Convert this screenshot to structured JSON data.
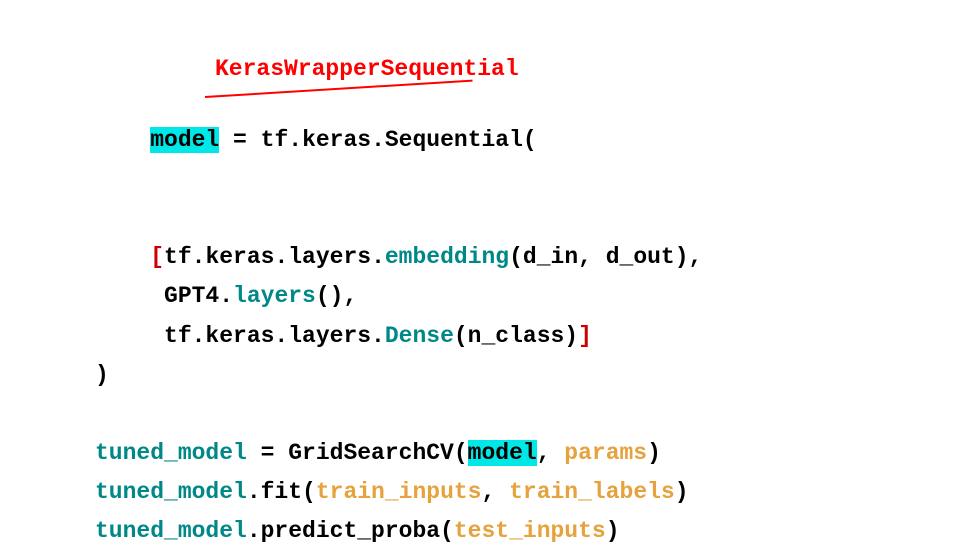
{
  "annotation": "KerasWrapperSequential",
  "code": {
    "l1": {
      "model": "model",
      "eq": " = ",
      "struck": "tf.keras.Sequential",
      "paren": "("
    },
    "l2": {
      "indent": "    ",
      "br_open": "[",
      "prefix": "tf.keras.layers.",
      "embedding": "embedding",
      "args": "(d_in, d_out),"
    },
    "l3": {
      "indent": "     ",
      "prefix": "GPT4.",
      "layers": "layers",
      "tail": "(),"
    },
    "l4": {
      "indent": "     ",
      "prefix": "tf.keras.layers.",
      "dense": "Dense",
      "args": "(n_class)",
      "br_close": "]"
    },
    "l5": {
      "text": ")"
    },
    "l6": {
      "text": " "
    },
    "l7": {
      "tuned": "tuned_model",
      "mid": " = GridSearchCV(",
      "model": "model",
      "comma": ", ",
      "params": "params",
      "close": ")"
    },
    "l8": {
      "tuned": "tuned_model",
      "fit": ".fit(",
      "a1": "train_inputs",
      "c": ", ",
      "a2": "train_labels",
      "close": ")"
    },
    "l9": {
      "tuned": "tuned_model",
      "pred": ".predict_proba(",
      "a1": "test_inputs",
      "close": ")"
    }
  }
}
